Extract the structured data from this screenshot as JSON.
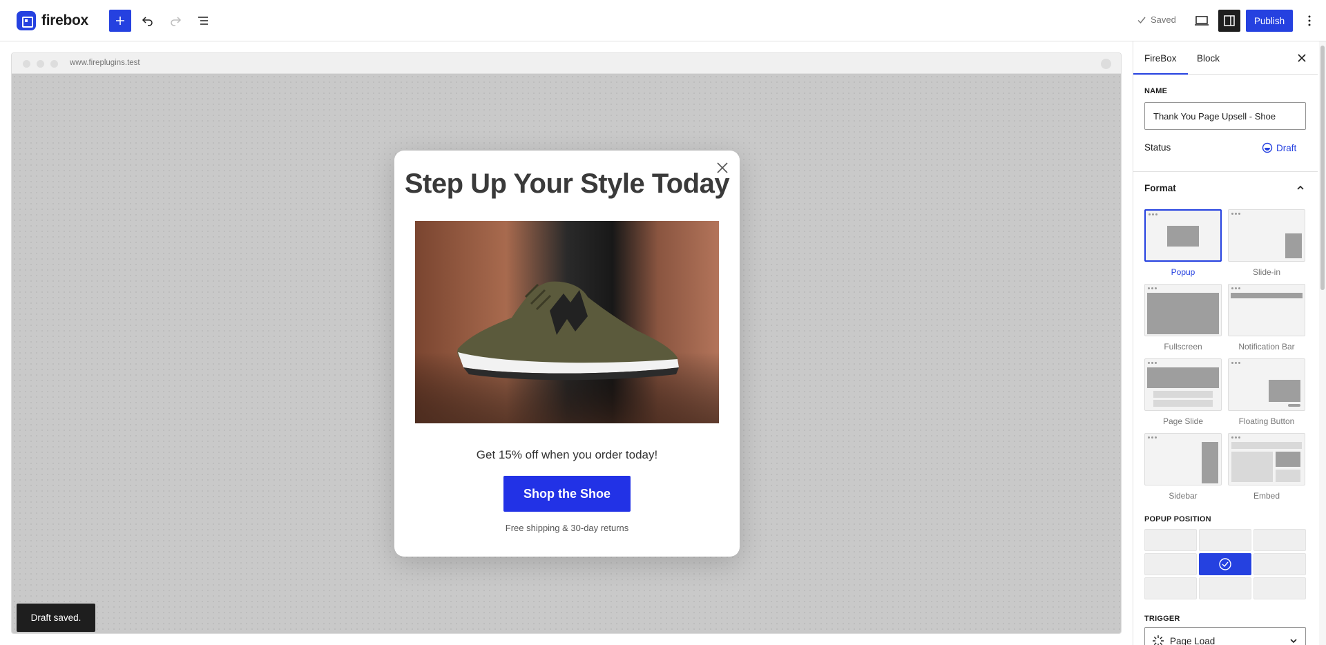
{
  "app": {
    "brand": "firebox"
  },
  "toolbar": {
    "saved_label": "Saved",
    "publish_label": "Publish"
  },
  "preview": {
    "url": "www.fireplugins.test",
    "popup": {
      "title": "Step Up Your Style Today",
      "offer_text": "Get 15% off when you order today!",
      "cta_label": "Shop the Shoe",
      "footer_text": "Free shipping & 30-day returns"
    }
  },
  "snackbar": {
    "message": "Draft saved."
  },
  "sidebar": {
    "tabs": [
      "FireBox",
      "Block"
    ],
    "active_tab": "FireBox",
    "name_label": "NAME",
    "name_value": "Thank You Page Upsell - Shoe",
    "status_label": "Status",
    "status_value": "Draft",
    "format_heading": "Format",
    "formats": [
      {
        "label": "Popup",
        "selected": true
      },
      {
        "label": "Slide-in",
        "selected": false
      },
      {
        "label": "Fullscreen",
        "selected": false
      },
      {
        "label": "Notification Bar",
        "selected": false
      },
      {
        "label": "Page Slide",
        "selected": false
      },
      {
        "label": "Floating Button",
        "selected": false
      },
      {
        "label": "Sidebar",
        "selected": false
      },
      {
        "label": "Embed",
        "selected": false
      }
    ],
    "popup_position_label": "POPUP POSITION",
    "popup_position_selected": "middle-center",
    "trigger_label": "TRIGGER",
    "trigger_value": "Page Load"
  },
  "colors": {
    "accent": "#2541e0",
    "cta": "#2232e6"
  }
}
